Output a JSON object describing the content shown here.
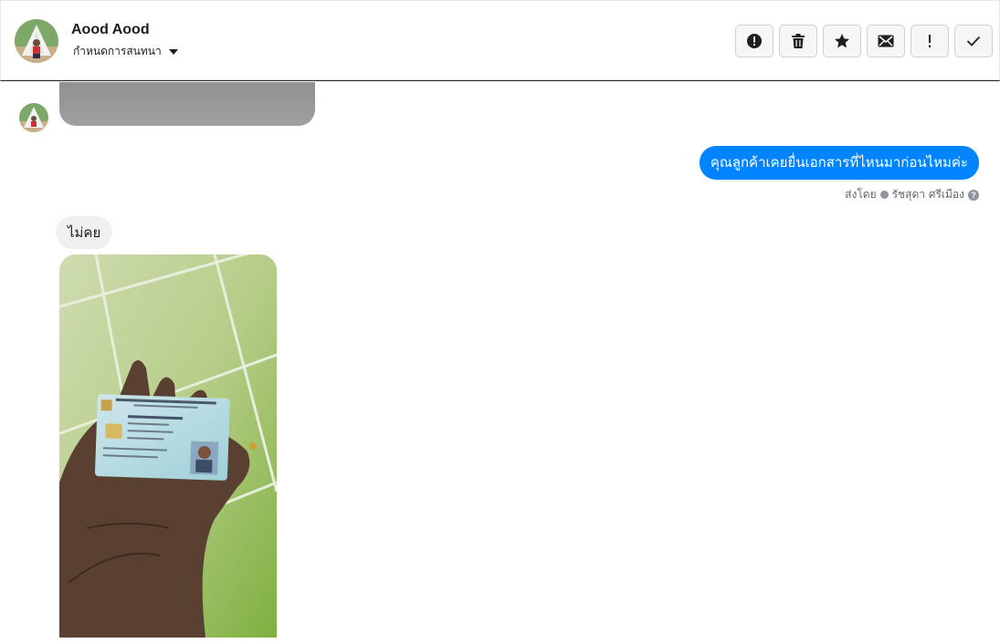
{
  "header": {
    "contact_name": "Aood Aood",
    "conversation_settings": "กำหนดการสนทนา",
    "toolbar": [
      {
        "name": "report-spam-button",
        "icon": "exclamation-circle-icon"
      },
      {
        "name": "delete-button",
        "icon": "trash-icon"
      },
      {
        "name": "star-button",
        "icon": "star-icon"
      },
      {
        "name": "mark-unread-button",
        "icon": "envelope-icon"
      },
      {
        "name": "mark-important-button",
        "icon": "exclamation-icon"
      },
      {
        "name": "mark-done-button",
        "icon": "checkmark-icon"
      }
    ]
  },
  "messages": {
    "outgoing_text": "คุณลูกค้าเคยยื่นเอกสารที่ไหนมาก่อนไหมค่ะ",
    "sent_by_label": "ส่งโดย",
    "sent_by_name": "รัชสุดา ศรีเมือง",
    "incoming_text": "ไม่คย"
  },
  "colors": {
    "outgoing_bubble": "#0084ff",
    "incoming_bubble": "#f1f0f0",
    "text_primary": "#1c1e21",
    "text_secondary": "#606770"
  }
}
